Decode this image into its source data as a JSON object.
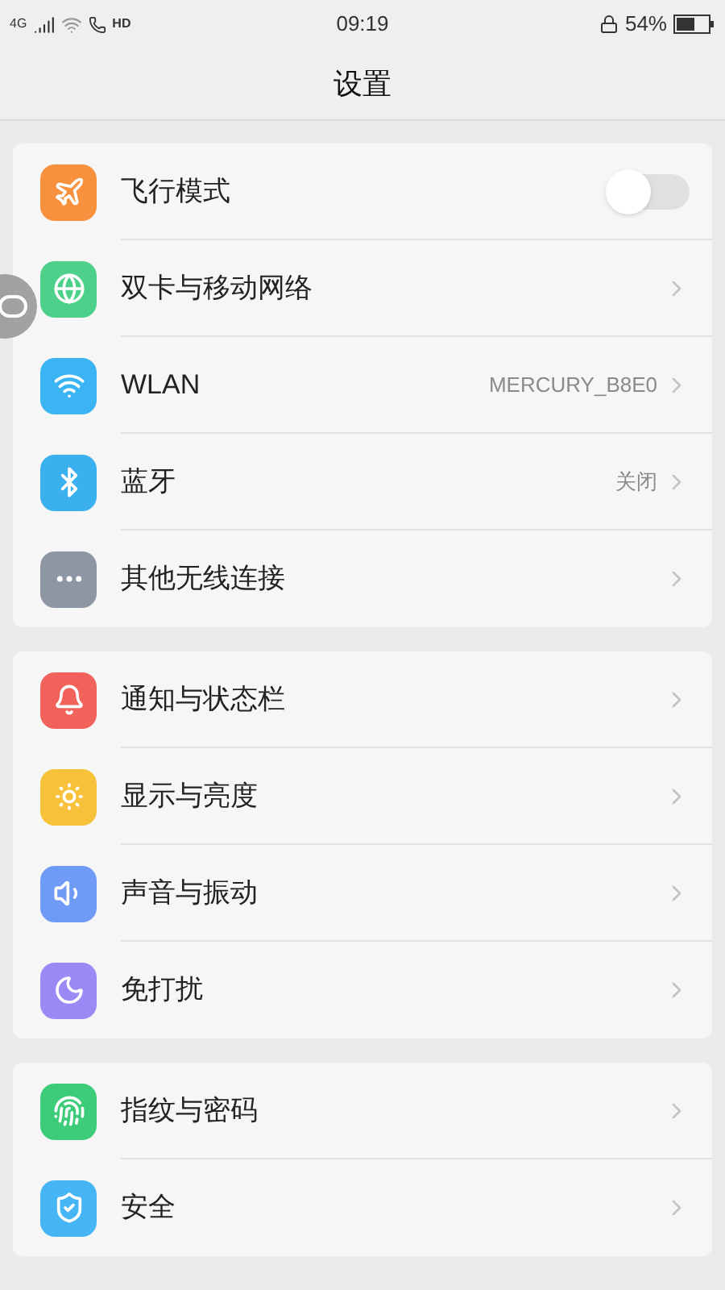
{
  "status_bar": {
    "network": "4G",
    "call": "HD",
    "time": "09:19",
    "battery": "54%"
  },
  "title": "设置",
  "groups": [
    {
      "items": [
        {
          "color": "#f7913d",
          "label": "飞行模式",
          "kind": "toggle",
          "on": false
        },
        {
          "color": "#4cd08a",
          "label": "双卡与移动网络",
          "kind": "link"
        },
        {
          "color": "#3ab4f2",
          "label": "WLAN",
          "kind": "link",
          "value": "MERCURY_B8E0"
        },
        {
          "color": "#3bb0ef",
          "label": "蓝牙",
          "kind": "link",
          "value": "关闭"
        },
        {
          "color": "#8e96a3",
          "label": "其他无线连接",
          "kind": "link"
        }
      ]
    },
    {
      "items": [
        {
          "color": "#f0625a",
          "label": "通知与状态栏",
          "kind": "link"
        },
        {
          "color": "#f7c13a",
          "label": "显示与亮度",
          "kind": "link"
        },
        {
          "color": "#6f9af5",
          "label": "声音与振动",
          "kind": "link"
        },
        {
          "color": "#9b8af5",
          "label": "免打扰",
          "kind": "link"
        }
      ]
    },
    {
      "items": [
        {
          "color": "#3dcc7a",
          "label": "指纹与密码",
          "kind": "link"
        },
        {
          "color": "#45b5f5",
          "label": "安全",
          "kind": "link"
        }
      ]
    }
  ]
}
